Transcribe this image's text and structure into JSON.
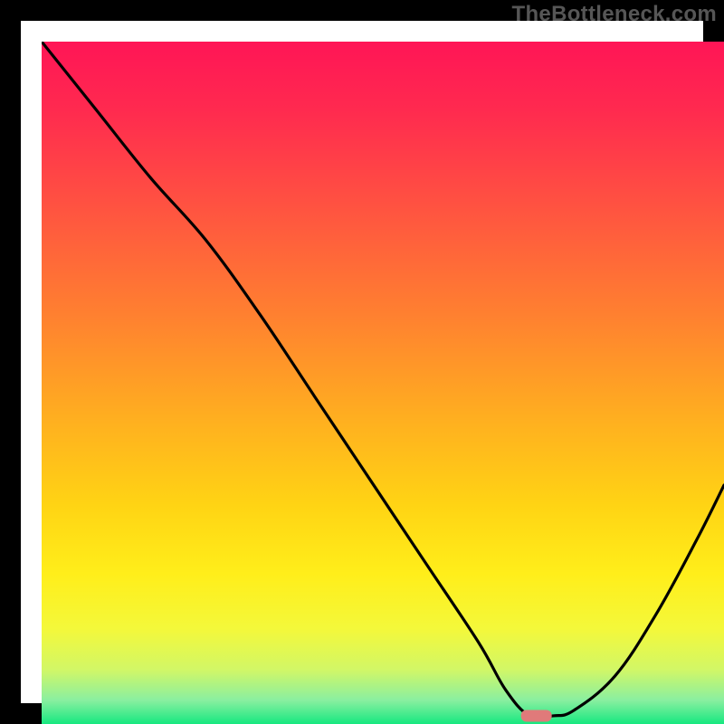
{
  "watermark": "TheBottleneck.com",
  "chart_data": {
    "type": "line",
    "title": "",
    "xlabel": "",
    "ylabel": "",
    "xlim": [
      0,
      100
    ],
    "ylim": [
      0,
      100
    ],
    "grid": false,
    "legend": false,
    "series": [
      {
        "name": "bottleneck-curve",
        "x": [
          0,
          8,
          16,
          24,
          32,
          40,
          48,
          56,
          64,
          68,
          71.5,
          75,
          78,
          84,
          90,
          96,
          100
        ],
        "values": [
          100,
          90,
          80,
          71,
          60,
          48,
          36,
          24,
          12,
          5,
          1.2,
          1.2,
          2,
          7,
          16,
          27,
          35
        ]
      }
    ],
    "markers": [
      {
        "name": "highlight-pill",
        "x": 72.5,
        "y": 1.2,
        "color": "#e07a7a"
      }
    ],
    "gradient_stops": [
      {
        "offset": 0.0,
        "color": "#ff1556"
      },
      {
        "offset": 0.1,
        "color": "#ff2a4f"
      },
      {
        "offset": 0.25,
        "color": "#ff5540"
      },
      {
        "offset": 0.4,
        "color": "#ff8030"
      },
      {
        "offset": 0.55,
        "color": "#ffae20"
      },
      {
        "offset": 0.68,
        "color": "#ffd414"
      },
      {
        "offset": 0.78,
        "color": "#ffee1a"
      },
      {
        "offset": 0.86,
        "color": "#f4f83a"
      },
      {
        "offset": 0.92,
        "color": "#d2f766"
      },
      {
        "offset": 0.965,
        "color": "#8aefa0"
      },
      {
        "offset": 1.0,
        "color": "#17e880"
      }
    ]
  }
}
